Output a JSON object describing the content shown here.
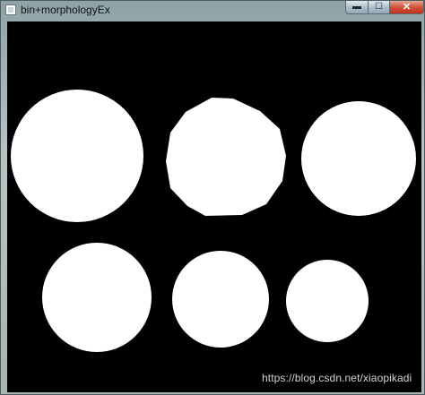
{
  "window": {
    "title": "bin+morphologyEx",
    "controls": {
      "minimize_label": "▬",
      "maximize_label": "☐",
      "close_label": "✕"
    }
  },
  "image": {
    "background_color": "#000000",
    "foreground_color": "#ffffff",
    "blob_count": 6
  },
  "watermark": "https://blog.csdn.net/xiaopikadi"
}
